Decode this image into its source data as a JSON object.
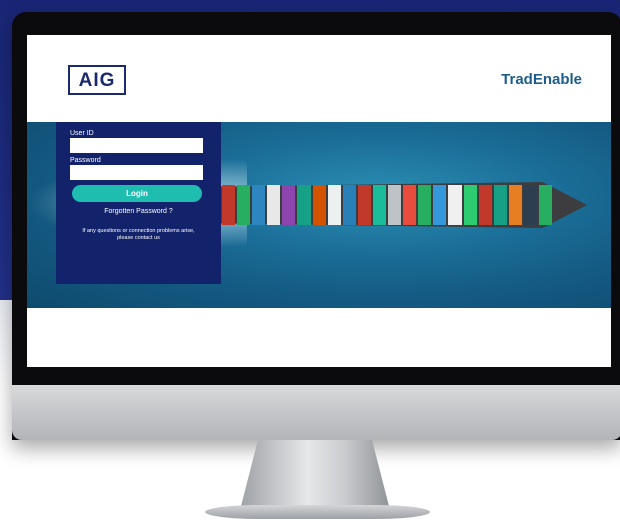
{
  "site": {
    "logo_text": "AIG",
    "brand_name": "TradEnable"
  },
  "login": {
    "user_id_label": "User ID",
    "user_id_value": "",
    "password_label": "Password",
    "password_value": "",
    "login_button_label": "Login",
    "forgot_password_link": "Forgotten Password ?",
    "contact_text": "If any questions or connection problems arise, please contact us"
  },
  "colors": {
    "navy_backdrop": "#1e2c80",
    "login_panel": "#12236b",
    "login_button": "#1fbcb0",
    "brand_text": "#1e5c8c"
  }
}
